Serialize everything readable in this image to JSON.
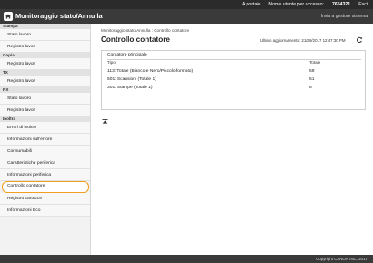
{
  "topbar": {
    "portal_link": "A portale",
    "user_label": "Nome utente per accesso:",
    "user_id": "7654321",
    "logout": "Esci"
  },
  "header": {
    "title": "Monitoraggio stato/Annulla",
    "system_button": "Invia a gestore sistema"
  },
  "sidebar": {
    "sections": [
      {
        "title": "Stampa",
        "items": [
          {
            "label": "Stato lavoro"
          },
          {
            "label": "Registro lavori"
          }
        ]
      },
      {
        "title": "Copia",
        "items": [
          {
            "label": "Registro lavori"
          }
        ]
      },
      {
        "title": "TX",
        "items": [
          {
            "label": "Registro lavori"
          }
        ]
      },
      {
        "title": "RX",
        "items": [
          {
            "label": "Stato lavoro"
          },
          {
            "label": "Registro lavori"
          }
        ]
      },
      {
        "title": "Inoltra",
        "items": [
          {
            "label": "Errori di inoltro"
          },
          {
            "label": "Informazioni sull'errore"
          },
          {
            "label": "Consumabili"
          },
          {
            "label": "Caratteristiche periferica"
          },
          {
            "label": "Informazioni periferica"
          },
          {
            "label": "Controllo contatore",
            "active": true
          },
          {
            "label": "Registro cartucce"
          },
          {
            "label": "Informazioni Eco"
          }
        ]
      }
    ]
  },
  "main": {
    "breadcrumb": "Monitoraggio stato/Annulla : Controllo contatore",
    "title": "Controllo contatore",
    "last_updated_label": "Ultimo aggiornamento:",
    "last_updated_value": "21/09/2017 12:47:30 PM",
    "panel": {
      "title": "Contatore principale",
      "col_type": "Tipo",
      "col_total": "Totale",
      "rows": [
        {
          "type": "113: Totale (Bianco e Nero/Piccolo formato)",
          "total": "59"
        },
        {
          "type": "501: Scansioni (Totale 1)",
          "total": "51"
        },
        {
          "type": "301: Stampe (Totale 1)",
          "total": "8"
        }
      ]
    }
  },
  "footer": {
    "copyright": "Copyright CANON INC. 2017"
  },
  "colors": {
    "header_bg": "#3a3a3a",
    "topbar_bg": "#2b2b2b",
    "active_outline": "#f0a020"
  }
}
